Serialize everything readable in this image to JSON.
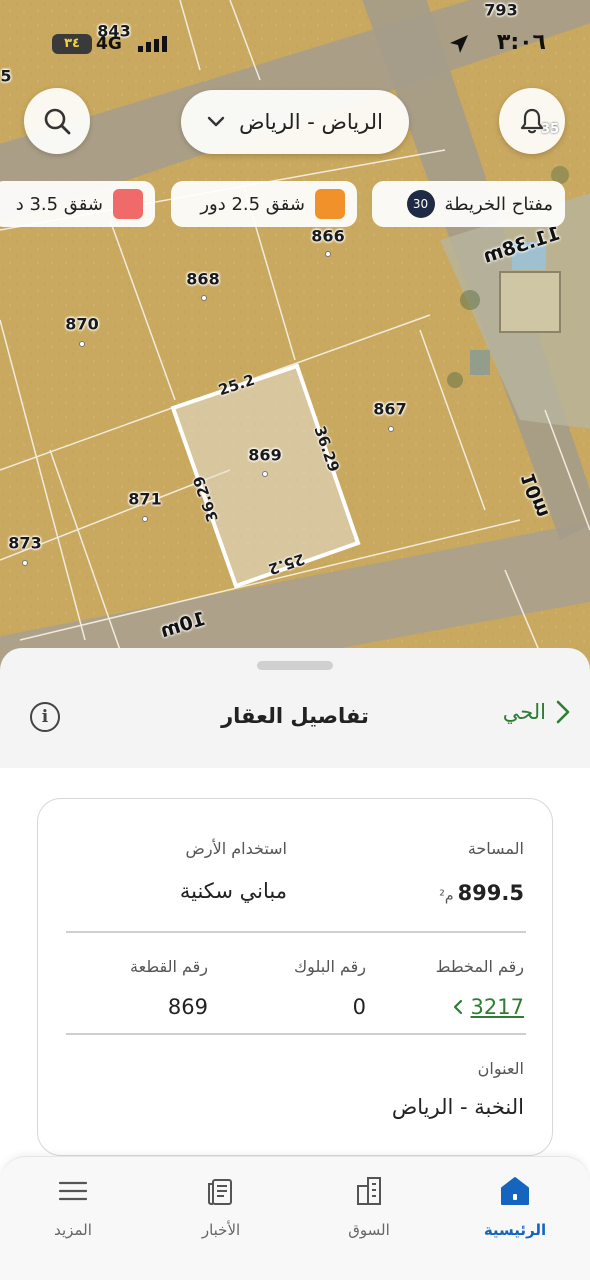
{
  "status_bar": {
    "time": "٣:٠٦",
    "battery": "٣٤",
    "network": "4G"
  },
  "map": {
    "city_selector": "الرياض - الرياض",
    "legend": [
      {
        "label": "مفتاح الخريطة",
        "badge": "30",
        "color": ""
      },
      {
        "label": "شقق 2.5 دور",
        "color": "#f0912a"
      },
      {
        "label": "شقق 3.5 د",
        "color": "#f06a6a"
      }
    ],
    "plots": [
      {
        "id": "793"
      },
      {
        "id": "843"
      },
      {
        "id": "866"
      },
      {
        "id": "868"
      },
      {
        "id": "870"
      },
      {
        "id": "869"
      },
      {
        "id": "867"
      },
      {
        "id": "871"
      },
      {
        "id": "873"
      }
    ],
    "notification_count": "35",
    "dimensions": [
      "25.2",
      "36.29",
      "36.29",
      "25.2"
    ],
    "streets": [
      "11.38m",
      "10m",
      "10m"
    ],
    "corner_fragment": "5"
  },
  "sheet": {
    "title": "تفاصيل العقار",
    "back_label": "الحي",
    "info_symbol": "i",
    "details": {
      "area_label": "المساحة",
      "area_value": "899.5",
      "area_unit": "م²",
      "land_use_label": "استخدام الأرض",
      "land_use_value": "مباني سكنية",
      "plan_label": "رقم المخطط",
      "plan_value": "3217",
      "block_label": "رقم البلوك",
      "block_value": "0",
      "plot_label": "رقم القطعة",
      "plot_value": "869",
      "address_label": "العنوان",
      "address_value": "النخبة - الرياض"
    }
  },
  "bottom_nav": {
    "items": [
      {
        "label": "الرئيسية",
        "icon": "home-icon",
        "active": true
      },
      {
        "label": "السوق",
        "icon": "buildings-icon",
        "active": false
      },
      {
        "label": "الأخبار",
        "icon": "news-icon",
        "active": false
      },
      {
        "label": "المزيد",
        "icon": "menu-icon",
        "active": false
      }
    ],
    "active_color": "#1565c0"
  }
}
